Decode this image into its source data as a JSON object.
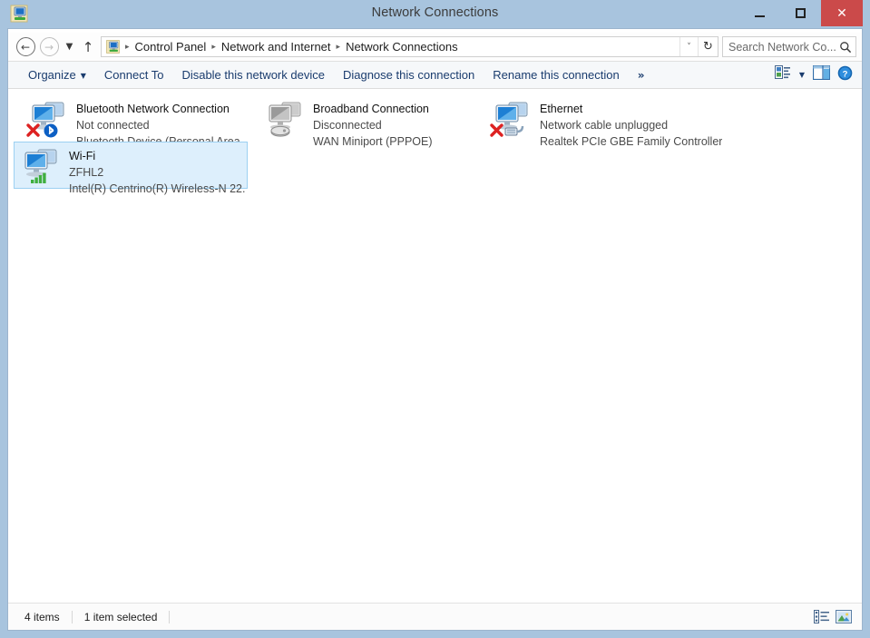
{
  "window": {
    "title": "Network Connections",
    "icon": "network-connections-icon",
    "controls": {
      "minimize": "–",
      "maximize": "□",
      "close": "✕"
    },
    "accent_title_bg": "#a8c4de",
    "close_btn_color": "#cb4a4a"
  },
  "address_bar": {
    "back": "←",
    "forward": "→",
    "recent_dropdown": "▼",
    "up": "↑",
    "path_icon": "network-connections-icon",
    "breadcrumbs": [
      {
        "label": "Control Panel"
      },
      {
        "label": "Network and Internet"
      },
      {
        "label": "Network Connections"
      }
    ],
    "separator": "▸",
    "path_dropdown": "˅",
    "refresh": "↻",
    "search": {
      "placeholder": "Search Network Co...",
      "value": "",
      "icon": "search-icon"
    }
  },
  "toolbar": {
    "items": [
      {
        "label": "Organize",
        "has_caret": true
      },
      {
        "label": "Connect To",
        "has_caret": false
      },
      {
        "label": "Disable this network device",
        "has_caret": false
      },
      {
        "label": "Diagnose this connection",
        "has_caret": false
      },
      {
        "label": "Rename this connection",
        "has_caret": false
      }
    ],
    "overflow": "»",
    "caret": "▼",
    "right_icons": [
      {
        "name": "change-view-icon"
      },
      {
        "name": "preview-pane-icon"
      },
      {
        "name": "help-icon"
      }
    ]
  },
  "connections": [
    {
      "name": "Bluetooth Network Connection",
      "status": "Not connected",
      "device": "Bluetooth Device (Personal Area ...",
      "icon": "network-adapter-icon",
      "adapter_state": "disabled",
      "badge": "bluetooth-icon",
      "selected": false
    },
    {
      "name": "Broadband Connection",
      "status": "Disconnected",
      "device": "WAN Miniport (PPPOE)",
      "icon": "network-adapter-icon",
      "adapter_state": "greyed",
      "badge": "modem-icon",
      "selected": false
    },
    {
      "name": "Ethernet",
      "status": "Network cable unplugged",
      "device": "Realtek PCIe GBE Family Controller",
      "icon": "network-adapter-icon",
      "adapter_state": "unplugged",
      "badge": "rj45-cable-icon",
      "selected": false
    },
    {
      "name": "Wi-Fi",
      "status": "ZFHL2",
      "device": "Intel(R) Centrino(R) Wireless-N 22...",
      "icon": "network-adapter-icon",
      "adapter_state": "connected",
      "badge": "wifi-signal-icon",
      "selected": true
    }
  ],
  "status_bar": {
    "item_count": "4 items",
    "selection": "1 item selected",
    "view_buttons": [
      {
        "name": "details-view-button"
      },
      {
        "name": "large-icons-view-button"
      }
    ]
  }
}
